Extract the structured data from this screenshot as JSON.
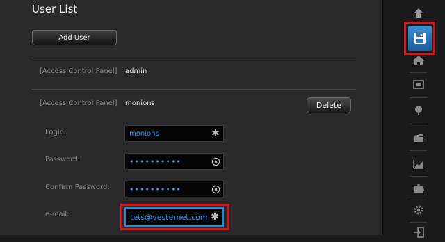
{
  "page": {
    "title": "User List"
  },
  "actions": {
    "add_user_label": "Add User",
    "delete_label": "Delete"
  },
  "users": [
    {
      "panel_label": "[Access Control Panel]",
      "username": "admin"
    },
    {
      "panel_label": "[Access Control Panel]",
      "username": "monions"
    }
  ],
  "form": {
    "login_label": "Login:",
    "login_value": "monions",
    "password_label": "Password:",
    "password_value": "••••••••••",
    "confirm_label": "Confirm Password:",
    "confirm_value": "••••••••••",
    "email_label": "e-mail:",
    "email_value": "tets@vesternet.com"
  },
  "dock": {
    "icons": [
      "up-arrow-icon",
      "save-icon",
      "home-icon",
      "device-icon",
      "scene-icon",
      "clapper-icon",
      "chart-icon",
      "puzzle-icon",
      "settings-icon",
      "logout-icon"
    ]
  },
  "colors": {
    "accent": "#1e88e5",
    "highlight": "#d6141a",
    "input_text": "#3b97ee"
  }
}
